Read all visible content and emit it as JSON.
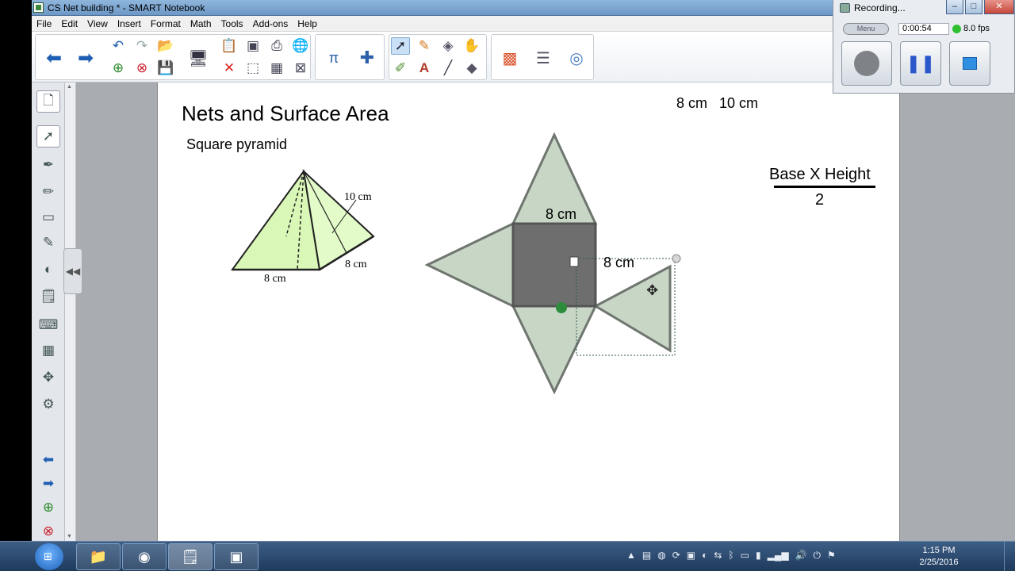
{
  "window": {
    "title": "CS Net building * - SMART Notebook",
    "min_label": "–",
    "max_label": "□",
    "close_label": "✕"
  },
  "menu": [
    "File",
    "Edit",
    "View",
    "Insert",
    "Format",
    "Math",
    "Tools",
    "Add-ons",
    "Help"
  ],
  "page": {
    "title": "Nets and Surface Area",
    "subtitle": "Square pyramid",
    "dims_top": "8 cm   10 cm",
    "pyramid_slant_label": "10 cm",
    "pyramid_front_label": "8 cm",
    "pyramid_side_label": "8 cm",
    "net_top_label": "8 cm",
    "net_right_label": "8 cm",
    "formula_numerator": "Base X Height",
    "formula_denominator": "2",
    "colors": {
      "net_fill": "#c7d6c5",
      "net_stroke": "#6f756f",
      "square_fill": "#6e6e6e",
      "pyramid_fill": "#d9f7b6"
    }
  },
  "recorder": {
    "title": "Recording...",
    "menu_label": "Menu",
    "time": "0:00:54",
    "fps": "8.0 fps"
  },
  "taskbar": {
    "time": "1:15 PM",
    "date": "2/25/2016"
  }
}
